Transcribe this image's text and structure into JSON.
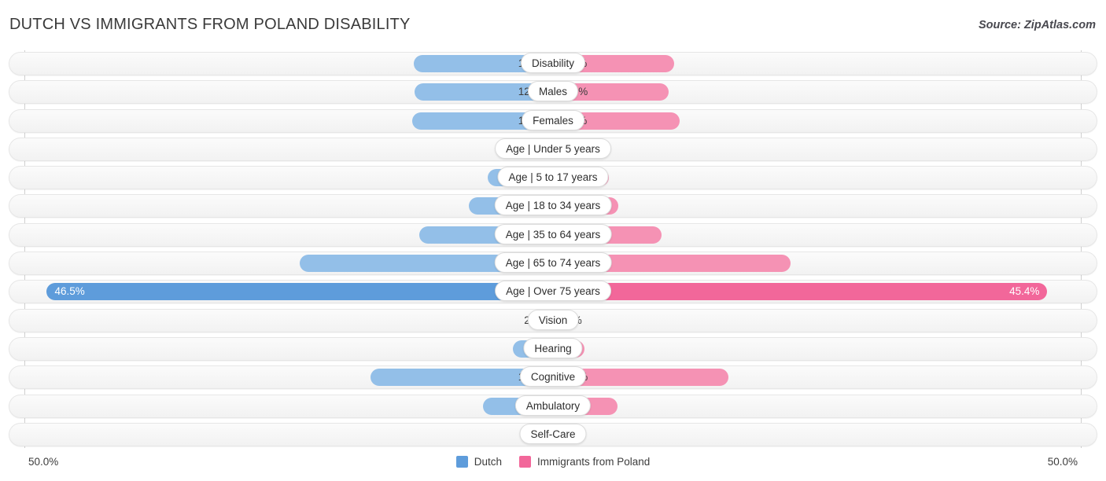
{
  "header": {
    "title": "DUTCH VS IMMIGRANTS FROM POLAND DISABILITY",
    "source": "Source: ZipAtlas.com"
  },
  "footer": {
    "axis_left": "50.0%",
    "axis_right": "50.0%",
    "legend": [
      {
        "label": "Dutch",
        "color": "#5e9cdb",
        "swatch": "dutch"
      },
      {
        "label": "Immigrants from Poland",
        "color": "#f2679a",
        "swatch": "poland"
      }
    ]
  },
  "colors": {
    "dutch_light": "#93bfe8",
    "dutch_dark": "#5e9cdb",
    "poland_light": "#f592b4",
    "poland_dark": "#f2679a",
    "track": "#f7f7f7",
    "axis": "#cfcfcf"
  },
  "chart_data": {
    "type": "bar",
    "orientation": "diverging-horizontal",
    "title": "DUTCH VS IMMIGRANTS FROM POLAND DISABILITY",
    "xlabel": "",
    "ylabel": "",
    "xlim": [
      0,
      50
    ],
    "axis_max_label": "50.0%",
    "grid": false,
    "legend_position": "bottom-center",
    "categories": [
      "Disability",
      "Males",
      "Females",
      "Age | Under 5 years",
      "Age | 5 to 17 years",
      "Age | 18 to 34 years",
      "Age | 35 to 64 years",
      "Age | 65 to 74 years",
      "Age | Over 75 years",
      "Vision",
      "Hearing",
      "Cognitive",
      "Ambulatory",
      "Self-Care"
    ],
    "series": [
      {
        "name": "Dutch",
        "color": "#93bfe8",
        "values": [
          12.8,
          12.7,
          12.9,
          1.7,
          6.0,
          7.7,
          12.3,
          23.3,
          46.5,
          2.2,
          3.7,
          16.8,
          6.4,
          2.4
        ]
      },
      {
        "name": "Immigrants from Poland",
        "color": "#f592b4",
        "values": [
          11.1,
          10.6,
          11.6,
          1.3,
          5.1,
          6.0,
          10.0,
          21.8,
          45.4,
          2.0,
          2.9,
          16.1,
          5.9,
          2.4
        ]
      }
    ]
  },
  "rows": [
    {
      "label": "Disability",
      "left_value": "12.8%",
      "right_value": "11.1%",
      "left_pct": 12.8,
      "right_pct": 11.1,
      "highlight": false
    },
    {
      "label": "Males",
      "left_value": "12.7%",
      "right_value": "10.6%",
      "left_pct": 12.7,
      "right_pct": 10.6,
      "highlight": false
    },
    {
      "label": "Females",
      "left_value": "12.9%",
      "right_value": "11.6%",
      "left_pct": 12.9,
      "right_pct": 11.6,
      "highlight": false
    },
    {
      "label": "Age | Under 5 years",
      "left_value": "1.7%",
      "right_value": "1.3%",
      "left_pct": 1.7,
      "right_pct": 1.3,
      "highlight": false
    },
    {
      "label": "Age | 5 to 17 years",
      "left_value": "6.0%",
      "right_value": "5.1%",
      "left_pct": 6.0,
      "right_pct": 5.1,
      "highlight": false
    },
    {
      "label": "Age | 18 to 34 years",
      "left_value": "7.7%",
      "right_value": "6.0%",
      "left_pct": 7.7,
      "right_pct": 6.0,
      "highlight": false
    },
    {
      "label": "Age | 35 to 64 years",
      "left_value": "12.3%",
      "right_value": "10.0%",
      "left_pct": 12.3,
      "right_pct": 10.0,
      "highlight": false
    },
    {
      "label": "Age | 65 to 74 years",
      "left_value": "23.3%",
      "right_value": "21.8%",
      "left_pct": 23.3,
      "right_pct": 21.8,
      "highlight": false
    },
    {
      "label": "Age | Over 75 years",
      "left_value": "46.5%",
      "right_value": "45.4%",
      "left_pct": 46.5,
      "right_pct": 45.4,
      "highlight": true
    },
    {
      "label": "Vision",
      "left_value": "2.2%",
      "right_value": "2.0%",
      "left_pct": 2.2,
      "right_pct": 2.0,
      "highlight": false
    },
    {
      "label": "Hearing",
      "left_value": "3.7%",
      "right_value": "2.9%",
      "left_pct": 3.7,
      "right_pct": 2.9,
      "highlight": false
    },
    {
      "label": "Cognitive",
      "left_value": "16.8%",
      "right_value": "16.1%",
      "left_pct": 16.8,
      "right_pct": 16.1,
      "highlight": false
    },
    {
      "label": "Ambulatory",
      "left_value": "6.4%",
      "right_value": "5.9%",
      "left_pct": 6.4,
      "right_pct": 5.9,
      "highlight": false
    },
    {
      "label": "Self-Care",
      "left_value": "2.4%",
      "right_value": "2.4%",
      "left_pct": 2.4,
      "right_pct": 2.4,
      "highlight": false
    }
  ]
}
